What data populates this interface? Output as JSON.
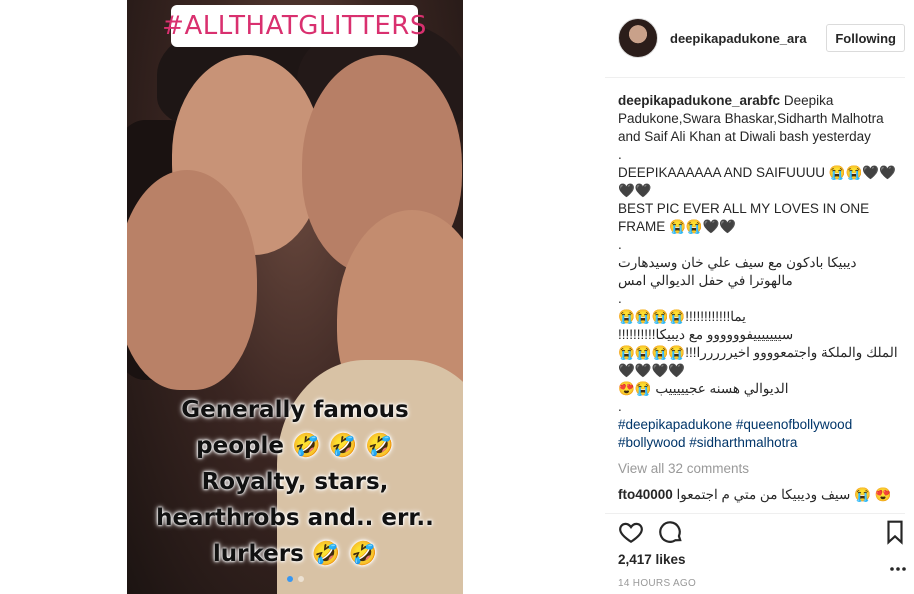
{
  "photo": {
    "hashtag_sticker": "#ALLTHATGLITTERS",
    "overlay_lines": [
      "Generally famous",
      "people 🤣 🤣 🤣",
      "Royalty, stars,",
      "hearthrobs and.. err..",
      "lurkers 🤣 🤣"
    ],
    "carousel": {
      "count": 2,
      "active_index": 0
    }
  },
  "header": {
    "username": "deepikapadukone_ara",
    "follow_label": "Following"
  },
  "post": {
    "caption_user": "deepikapadukone_arabfc",
    "caption_text": "Deepika Padukone,Swara Bhaskar,Sidharth Malhotra and Saif Ali Khan at Diwali bash yesterday",
    "lines": [
      ".",
      "DEEPIKAAAAAA AND SAIFUUUU 😭😭🖤🖤🖤🖤",
      "BEST PIC EVER ALL MY LOVES IN ONE FRAME 😭😭🖤🖤",
      ".",
      "ديبيكا بادكون مع سيف علي خان وسيدهارت مالهوترا في حفل الديوالي امس",
      ".",
      "يما!!!!!!!!!!!!😭😭😭😭",
      "سيييييييفوووووو مع ديبيكا!!!!!!!!!!",
      "الملك والملكة واجتمعوووو اخيرررررا!!!😭😭😭😭",
      "🖤🖤🖤🖤",
      "الديوالي هسنه عجيييييب 😭😍",
      "."
    ],
    "hashtags": "#deepikapadukone #queenofbollywood #bollywood #sidharthmalhotra",
    "view_all": "View all 32 comments",
    "comment": {
      "user": "fto40000",
      "text": "سيف وديبيكا من متي م اجتمعوا 😭 😍💔"
    },
    "likes": "2,417 likes",
    "timestamp": "14 HOURS AGO"
  },
  "icons": {
    "like": "heart-icon",
    "comment": "comment-icon",
    "save": "bookmark-icon",
    "more": "more-icon"
  }
}
